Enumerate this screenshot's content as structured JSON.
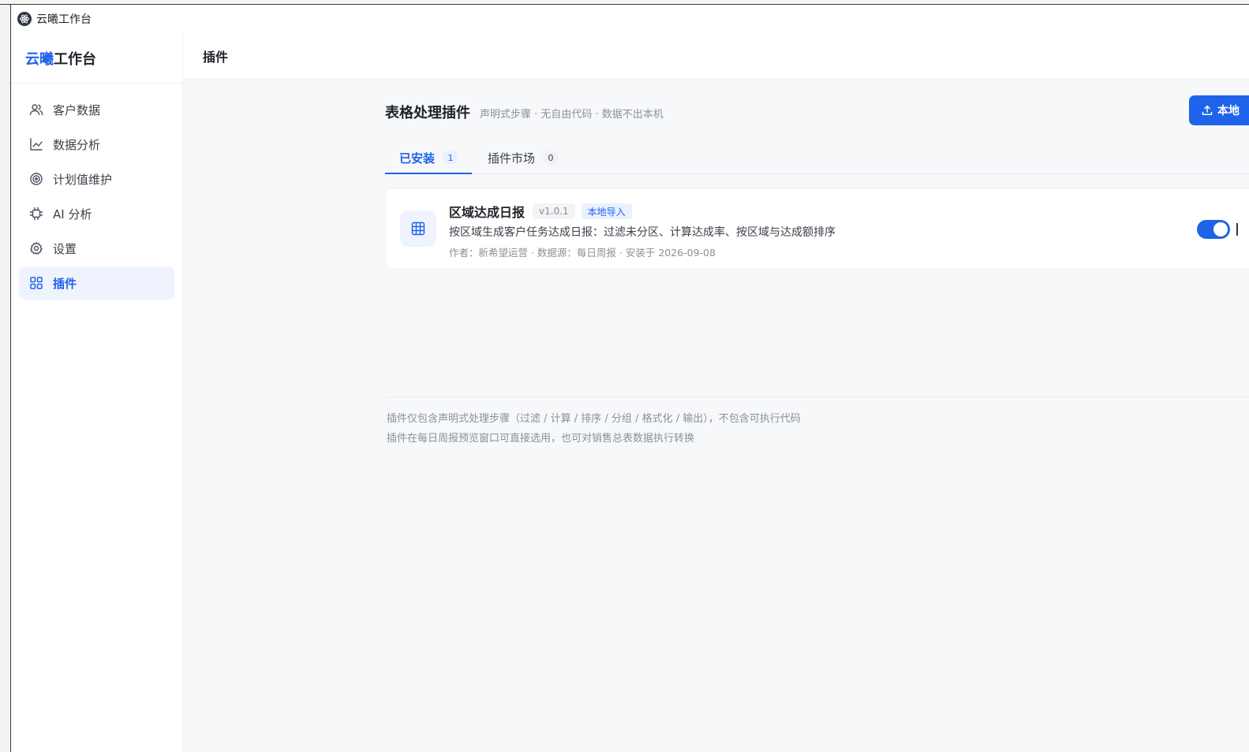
{
  "window": {
    "title": "云曦工作台"
  },
  "sidebar": {
    "brand_accent": "云曦",
    "brand_rest": "工作台",
    "items": [
      {
        "label": "客户数据",
        "icon": "users-icon"
      },
      {
        "label": "数据分析",
        "icon": "line-chart-icon"
      },
      {
        "label": "计划值维护",
        "icon": "target-icon"
      },
      {
        "label": "AI 分析",
        "icon": "chip-icon"
      },
      {
        "label": "设置",
        "icon": "gear-icon"
      },
      {
        "label": "插件",
        "icon": "grid-icon",
        "active": true
      }
    ]
  },
  "header": {
    "title": "插件"
  },
  "section": {
    "title": "表格处理插件",
    "subtitle": "声明式步骤 · 无自由代码 · 数据不出本机",
    "import_button": "本地"
  },
  "tabs": [
    {
      "label": "已安装",
      "count": "1",
      "active": true
    },
    {
      "label": "插件市场",
      "count": "0",
      "active": false
    }
  ],
  "plugins": [
    {
      "name": "区域达成日报",
      "version": "v1.0.1",
      "source": "本地导入",
      "description": "按区域生成客户任务达成日报：过滤未分区、计算达成率、按区域与达成额排序",
      "meta": "作者：新希望运营 · 数据源：每日周报 · 安装于 2026-09-08",
      "enabled": true
    }
  ],
  "footer": {
    "line1": "插件仅包含声明式处理步骤（过滤 / 计算 / 排序 / 分组 / 格式化 / 输出），不包含可执行代码",
    "line2": "插件在每日周报预览窗口可直接选用，也可对销售总表数据执行转换"
  },
  "colors": {
    "accent": "#1e63e9",
    "active_bg": "#eef3fd",
    "page_bg": "#f7f8fa"
  }
}
